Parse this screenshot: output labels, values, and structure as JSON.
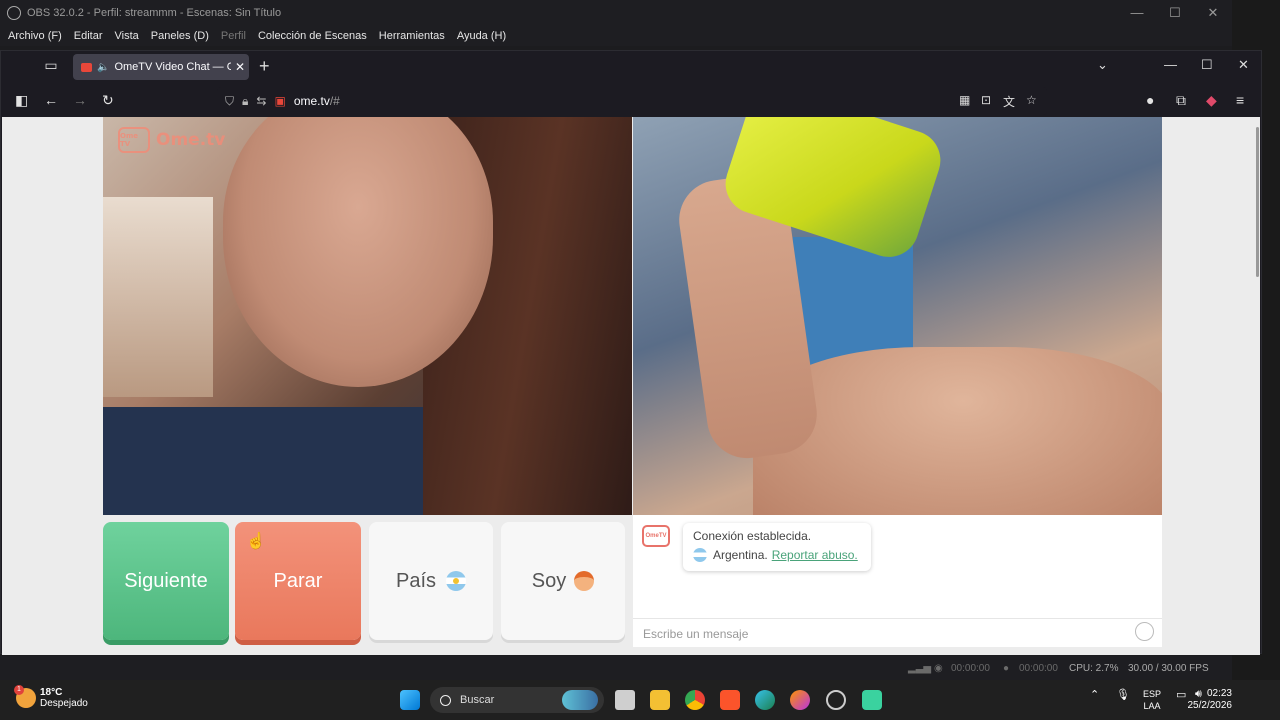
{
  "obs": {
    "title": "OBS 32.0.2 - Perfil: streammm - Escenas: Sin Título",
    "menu": [
      "Archivo (F)",
      "Editar",
      "Vista",
      "Paneles (D)",
      "Perfil",
      "Colección de Escenas",
      "Herramientas",
      "Ayuda (H)"
    ],
    "status": {
      "rec_time": "00:00:00",
      "stream_time": "00:00:00",
      "cpu": "CPU: 2.7%",
      "fps": "30.00 / 30.00 FPS"
    }
  },
  "browser": {
    "tab_title": "OmeTV Video Chat — Ome",
    "url": "ome.tv",
    "url_hash": "/#"
  },
  "page": {
    "logo_text": "Ome.tv",
    "logo_tv": "Ome TV",
    "buttons": {
      "next": "Siguiente",
      "stop": "Parar",
      "country": "País",
      "me": "Soy"
    },
    "chat": {
      "line1": "Conexión establecida.",
      "country": "Argentina.",
      "report": "Reportar abuso.",
      "placeholder": "Escribe un mensaje"
    }
  },
  "taskbar": {
    "temp": "18°C",
    "weather": "Despejado",
    "weather_badge": "1",
    "search": "Buscar",
    "lang1": "ESP",
    "lang2": "LAA",
    "time": "02:23",
    "date": "25/2/2026"
  }
}
